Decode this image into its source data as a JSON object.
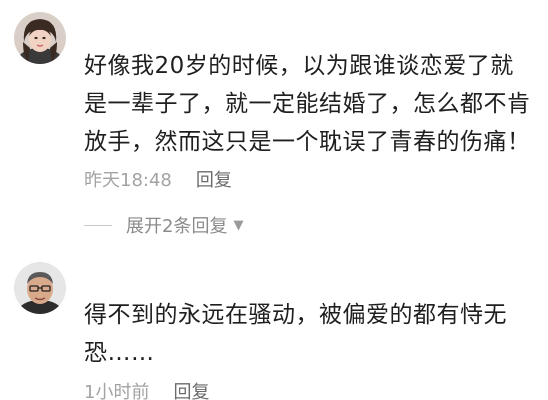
{
  "comments": [
    {
      "text": "好像我20岁的时候，以为跟谁谈恋爱了就是一辈子了，就一定能结婚了，怎么都不肯放手，然而这只是一个耽误了青春的伤痛！",
      "time": "昨天18:48",
      "reply_label": "回复",
      "expand_label": "展开2条回复"
    },
    {
      "text": "得不到的永远在骚动，被偏爱的都有恃无恐……",
      "time": "1小时前",
      "reply_label": "回复"
    }
  ],
  "icons": {
    "expand_caret": "caret-down-icon"
  }
}
